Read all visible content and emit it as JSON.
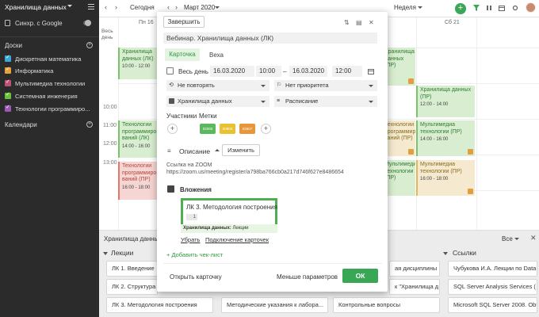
{
  "sidebar": {
    "title": "Хранилища данных",
    "sync_label": "Синхр. с Google",
    "boards_header": "Доски",
    "boards": [
      {
        "label": "Дискретная математика",
        "color": "#3fa7d6"
      },
      {
        "label": "Информатика",
        "color": "#e6a23c"
      },
      {
        "label": "Мультимедиа технологии",
        "color": "#c0507a"
      },
      {
        "label": "Системная инженерия",
        "color": "#67c23a"
      },
      {
        "label": "Технологии программиро...",
        "color": "#9b59b6"
      }
    ],
    "calendars_header": "Календари"
  },
  "header": {
    "today": "Сегодня",
    "month": "Март 2020",
    "view": "Неделя"
  },
  "grid": {
    "allday_label": "Весь день",
    "day_labels": [
      "Пн 16",
      "Сб 21"
    ],
    "times": [
      "10:00",
      "11:00",
      "12:00",
      "13:00"
    ],
    "events": [
      {
        "title": "Хранилища данных (ЛК)",
        "time": "10:00 - 12:00",
        "color": "green"
      },
      {
        "title": "Технологии программиро ваний (ЛК)",
        "time": "14:00 - 16:00",
        "color": "green"
      },
      {
        "title": "Технологии программиро ваний (ПР)",
        "time": "16:00 - 18:00",
        "color": "red"
      },
      {
        "title": "Хранилища данных (ПР)",
        "time": "",
        "color": "green"
      },
      {
        "title": "Хранилища данных (ПР)",
        "time": "12:00 - 14:00",
        "color": "green"
      },
      {
        "title": "Технологии программиро ваний (ПР)",
        "time": "",
        "color": "yellow"
      },
      {
        "title": "Мультимедиа технологии (ПР)",
        "time": "14:00 - 16:00",
        "color": "green"
      },
      {
        "title": "Мультимедиа технологии (ПР)",
        "time": "",
        "color": "green"
      },
      {
        "title": "Мультимедиа технологии (ПР)",
        "time": "16:00 - 18:00",
        "color": "yellow"
      }
    ]
  },
  "bottom_panel": {
    "title": "Хранилища данных",
    "filter": "Все",
    "lists": [
      {
        "name": "Лекции"
      },
      {
        "name": "Ссылки"
      }
    ],
    "cards": [
      "ЛК 1. Введение",
      "ЛК 2. Структура х",
      "ЛК 3. Методология построения",
      "Методические указания к лабора...",
      "Контрольные вопросы",
      "ая дисциплины",
      "к \"Хранилища д",
      "Чубукова И.А. Лекции по Data M",
      "SQL Server Analysis Services ( SS",
      "Microsoft SQL Server 2008. Obt"
    ]
  },
  "modal": {
    "finish_label": "Завершить",
    "title_value": "Вебинар. Хранилища данных (ЛК)",
    "tabs": [
      "Карточка",
      "Веха"
    ],
    "allday_label": "Весь день",
    "start_date": "16.03.2020",
    "start_time": "10:00",
    "dash": "–",
    "end_date": "16.03.2020",
    "end_time": "12:00",
    "repeat": "Не повторять",
    "priority": "Нет приоритета",
    "board": "Хранилища данных",
    "list": "Расписание",
    "participants_label": "Участники",
    "tags_label": "Метки",
    "tags": [
      {
        "label": "02000",
        "color": "#5cb85c"
      },
      {
        "label": "00800",
        "color": "#e8c230"
      },
      {
        "label": "02607",
        "color": "#e8963a"
      }
    ],
    "description_label": "Описание",
    "edit_label": "Изменить",
    "desc_line1": "Ссылка на ZOOM",
    "desc_line2": "https://zoom.us/meeting/register/a798ba766cb0a217d746f627e8486654",
    "attachments_label": "Вложения",
    "attach_name": "ЛК 3. Методология построения",
    "attach_count": "1",
    "attach_board": "Хранилища данных:",
    "attach_list": "Лекции",
    "remove_label": "Убрать",
    "connect_label": "Подключение карточек",
    "add_checklist": "+ Добавить чек-лист",
    "open_card": "Открыть карточку",
    "less_params": "Меньше параметров",
    "ok": "ОК"
  }
}
